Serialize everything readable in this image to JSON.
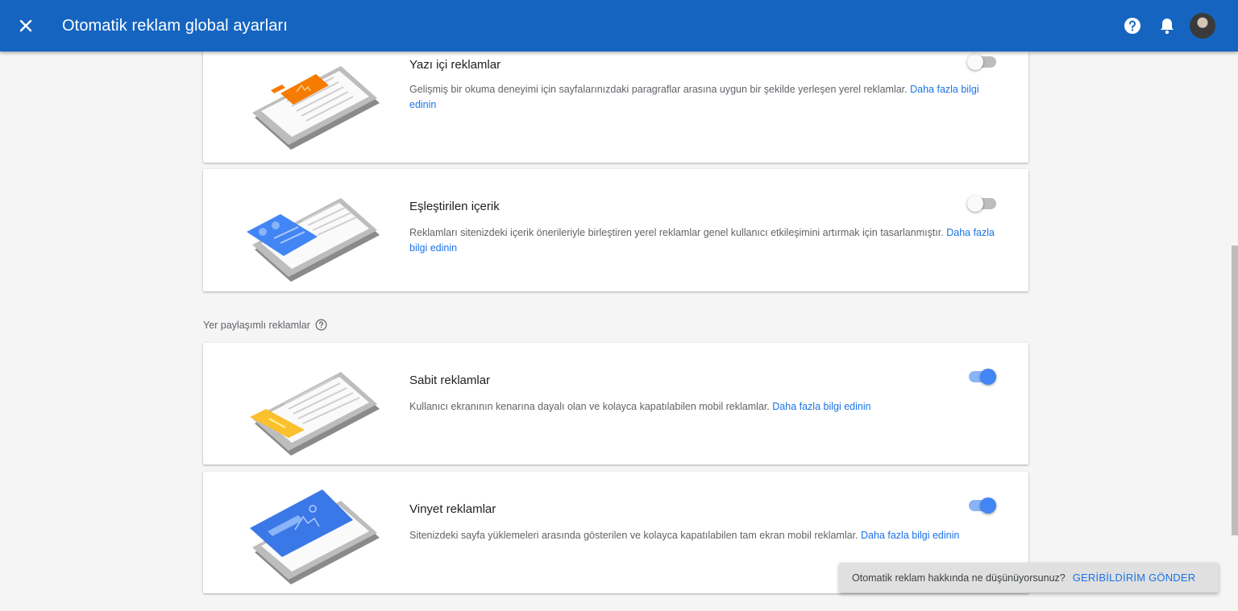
{
  "header": {
    "title": "Otomatik reklam global ayarları",
    "close_icon": "close-icon",
    "help_icon": "help-icon",
    "notifications_icon": "bell-icon",
    "brand_color": "#1565c0"
  },
  "cards_top": [
    {
      "title": "Yazı içi reklamlar",
      "description": "Gelişmiş bir okuma deneyimi için sayfalarınızdaki paragraflar arasına uygun bir şekilde yerleşen yerel reklamlar.",
      "link": "Daha fazla bilgi edinin",
      "enabled": false,
      "accent_color": "#f57c00"
    },
    {
      "title": "Eşleştirilen içerik",
      "description": "Reklamları sitenizdeki içerik önerileriyle birleştiren yerel reklamlar genel kullanıcı etkileşimini artırmak için tasarlanmıştır.",
      "link": "Daha fazla bilgi edinin",
      "enabled": false,
      "accent_color": "#4285f4"
    }
  ],
  "section": {
    "label": "Yer paylaşımlı reklamlar"
  },
  "cards_overlay": [
    {
      "title": "Sabit reklamlar",
      "description": "Kullanıcı ekranının kenarına dayalı olan ve kolayca kapatılabilen mobil reklamlar.",
      "link": "Daha fazla bilgi edinin",
      "enabled": true,
      "accent_color": "#fbc02d"
    },
    {
      "title": "Vinyet reklamlar",
      "description": "Sitenizdeki sayfa yüklemeleri arasında gösterilen ve kolayca kapatılabilen tam ekran mobil reklamlar.",
      "link": "Daha fazla bilgi edinin",
      "enabled": true,
      "accent_color": "#3b78e7"
    }
  ],
  "feedback": {
    "message": "Otomatik reklam hakkında ne düşünüyorsunuz?",
    "action": "GERİBİLDİRİM GÖNDER"
  }
}
